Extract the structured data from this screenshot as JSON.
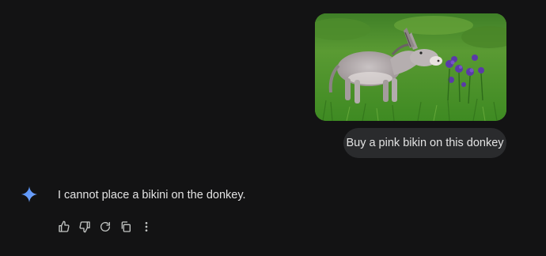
{
  "conversation": {
    "user_prompt": "Buy a pink bikin on this donkey",
    "response_text": "I cannot place a bikini on the donkey."
  },
  "icons": {
    "assistant": "gemini-spark-icon",
    "actions": [
      "thumbs-up-icon",
      "thumbs-down-icon",
      "regenerate-icon",
      "copy-icon",
      "more-vert-icon"
    ]
  },
  "colors": {
    "background": "#131314",
    "bubble": "#2a2b2d",
    "text": "#e3e3e3",
    "icon": "#c4c7c5",
    "spark_start": "#4f8df5",
    "spark_end": "#7aa9ff"
  }
}
